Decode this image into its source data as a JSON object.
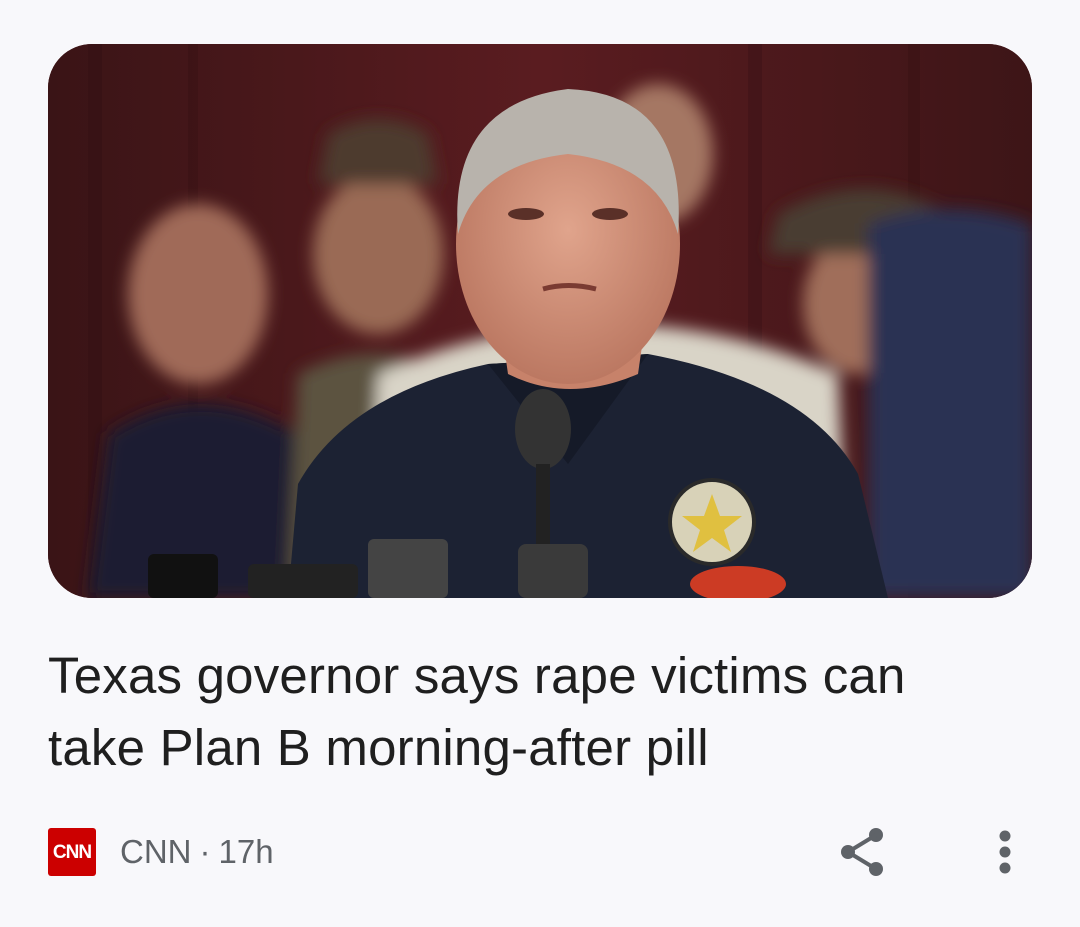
{
  "article": {
    "image_alt": "Photo of a man in a dark shirt speaking at microphones in front of people",
    "headline": "Texas governor says rape victims can take Plan B morning-after pill",
    "source": {
      "logo_text": "CNN",
      "logo_color": "#cc0000",
      "name": "CNN",
      "separator": "·",
      "age": "17h"
    },
    "actions": {
      "share_icon": "share-icon",
      "more_icon": "more-vertical-icon"
    }
  }
}
